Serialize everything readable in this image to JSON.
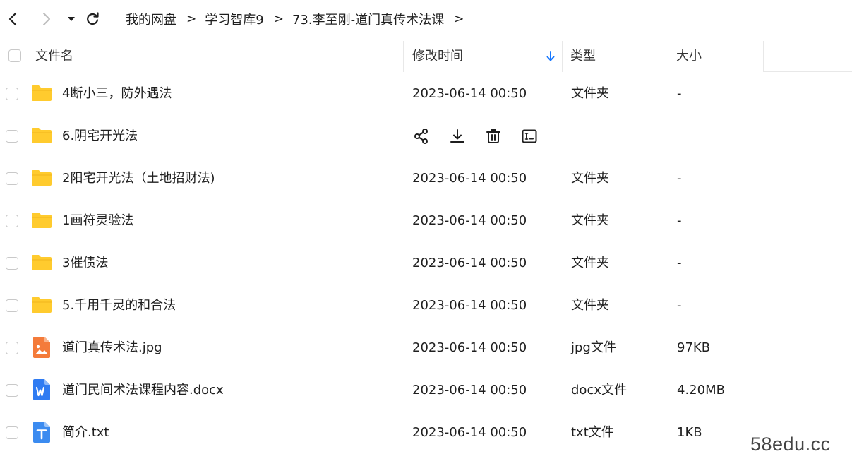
{
  "nav": {
    "breadcrumb": [
      "我的网盘",
      "学习智库9",
      "73.李至刚-道门真传术法课"
    ],
    "separator": ">"
  },
  "header": {
    "name": "文件名",
    "modified": "修改时间",
    "type": "类型",
    "size": "大小"
  },
  "rows": [
    {
      "name": "4断小三，防外遇法",
      "date": "2023-06-14 00:50",
      "type": "文件夹",
      "size": "-",
      "icon": "folder-icon"
    },
    {
      "name": "6.阴宅开光法",
      "date": "",
      "type": "",
      "size": "",
      "icon": "folder-icon"
    },
    {
      "name": "2阳宅开光法（土地招财法)",
      "date": "2023-06-14 00:50",
      "type": "文件夹",
      "size": "-",
      "icon": "folder-icon"
    },
    {
      "name": "1画符灵验法",
      "date": "2023-06-14 00:50",
      "type": "文件夹",
      "size": "-",
      "icon": "folder-icon"
    },
    {
      "name": "3催债法",
      "date": "2023-06-14 00:50",
      "type": "文件夹",
      "size": "-",
      "icon": "folder-icon"
    },
    {
      "name": "5.千用千灵的和合法",
      "date": "2023-06-14 00:50",
      "type": "文件夹",
      "size": "-",
      "icon": "folder-icon"
    },
    {
      "name": "道门真传术法.jpg",
      "date": "2023-06-14 00:50",
      "type": "jpg文件",
      "size": "97KB",
      "icon": "image-file-icon"
    },
    {
      "name": "道门民间术法课程内容.docx",
      "date": "2023-06-14 00:50",
      "type": "docx文件",
      "size": "4.20MB",
      "icon": "word-file-icon"
    },
    {
      "name": "简介.txt",
      "date": "2023-06-14 00:50",
      "type": "txt文件",
      "size": "1KB",
      "icon": "text-file-icon"
    }
  ],
  "hover_actions": [
    "share-icon",
    "download-icon",
    "delete-icon",
    "rename-icon"
  ],
  "colors": {
    "folder": "#FFCB2E",
    "image_file": "#F47B3A",
    "word_file": "#2F7BF2",
    "text_file": "#3B8BF0",
    "sort_arrow": "#1677FF"
  },
  "watermark": "58edu.cc"
}
